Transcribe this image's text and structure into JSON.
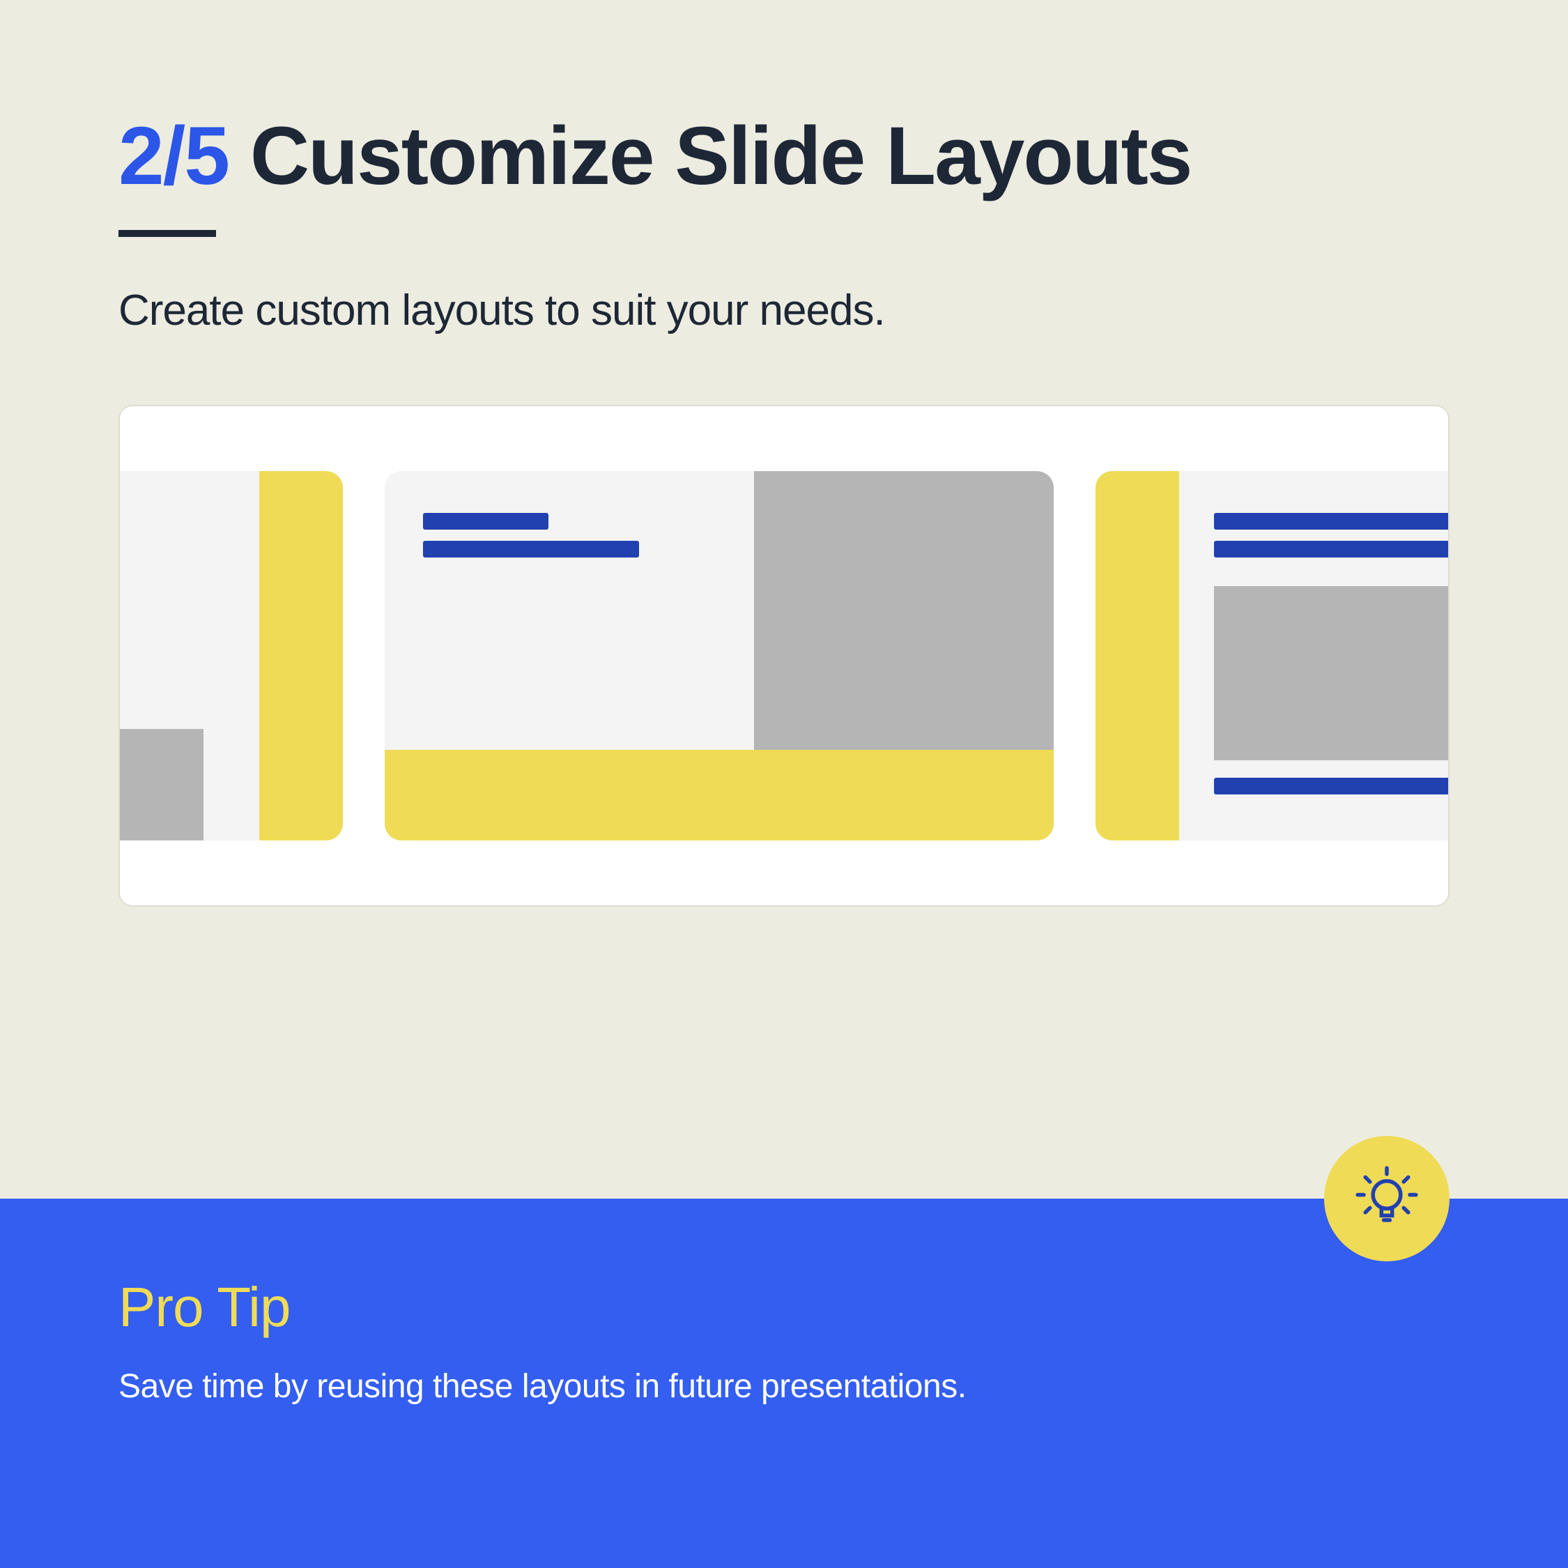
{
  "header": {
    "step_number": "2/5",
    "title": "Customize Slide Layouts",
    "subtitle": "Create custom layouts to suit your needs."
  },
  "tip": {
    "label": "Pro Tip",
    "body": "Save time by reusing these layouts in future presentations."
  },
  "colors": {
    "accent_blue": "#2c56e8",
    "dark": "#1e2736",
    "yellow": "#f0db56",
    "panel_blue": "#335ef0"
  }
}
